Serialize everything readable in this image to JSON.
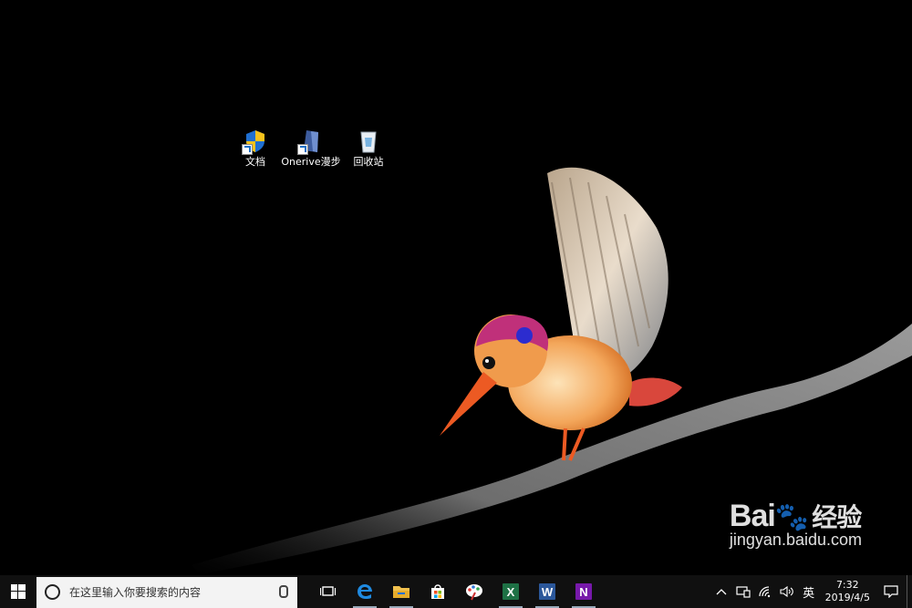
{
  "desktop": {
    "icons": [
      {
        "label": "文档",
        "icon": "shield-shortcut-icon"
      },
      {
        "label": "Onerive漫步",
        "icon": "document-shortcut-icon"
      },
      {
        "label": "回收站",
        "icon": "recycle-bin-icon"
      }
    ],
    "watermark": {
      "logo": "Bai",
      "logo_cn": "经验",
      "url": "jingyan.baidu.com"
    }
  },
  "taskbar": {
    "search_placeholder": "在这里输入你要搜索的内容",
    "apps": [
      {
        "name": "edge",
        "icon": "edge-icon"
      },
      {
        "name": "file-explorer",
        "icon": "folder-icon"
      },
      {
        "name": "store",
        "icon": "store-icon"
      },
      {
        "name": "paint",
        "icon": "paint-icon"
      },
      {
        "name": "excel",
        "icon": "excel-icon",
        "letter": "X"
      },
      {
        "name": "word",
        "icon": "word-icon",
        "letter": "W"
      },
      {
        "name": "onenote",
        "icon": "onenote-icon",
        "letter": "N"
      }
    ],
    "tray": {
      "ime": "英",
      "time": "7:32",
      "date": "2019/4/5"
    }
  },
  "colors": {
    "taskbar": "#101010",
    "search_bg": "#f3f3f3",
    "excel": "#1e7145",
    "word": "#2b579a",
    "onenote": "#7719aa"
  }
}
